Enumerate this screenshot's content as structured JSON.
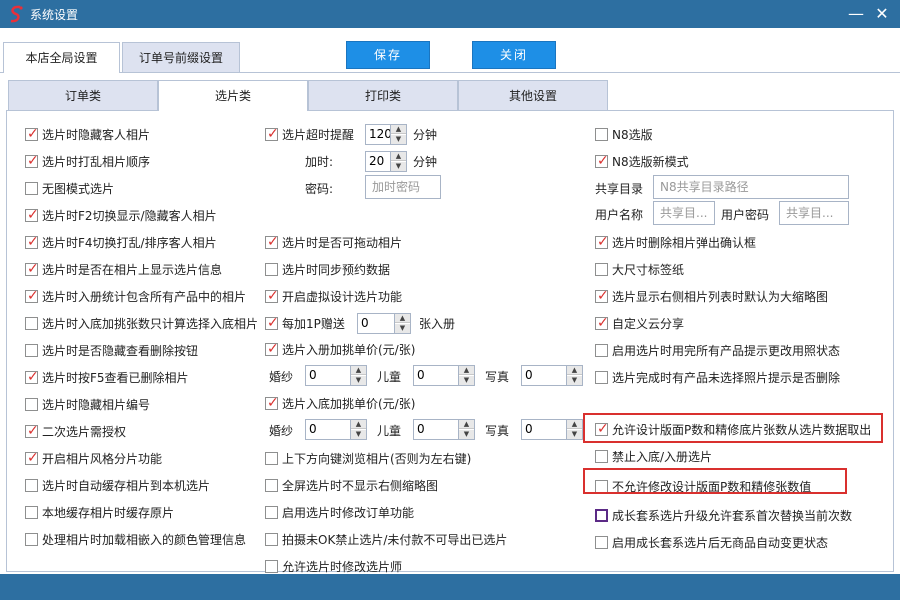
{
  "window": {
    "title": "系统设置",
    "minimize": "—",
    "close": "✕"
  },
  "top_tabs": [
    "本店全局设置",
    "订单号前缀设置"
  ],
  "buttons": {
    "save": "保存",
    "close": "关闭"
  },
  "sub_tabs": [
    "订单类",
    "选片类",
    "打印类",
    "其他设置"
  ],
  "col1": [
    {
      "label": "选片时隐藏客人相片",
      "checked": true
    },
    {
      "label": "选片时打乱相片顺序",
      "checked": true
    },
    {
      "label": "无图模式选片",
      "checked": false
    },
    {
      "label": "选片时F2切换显示/隐藏客人相片",
      "checked": true
    },
    {
      "label": "选片时F4切换打乱/排序客人相片",
      "checked": true
    },
    {
      "label": "选片时是否在相片上显示选片信息",
      "checked": true
    },
    {
      "label": "选片时入册统计包含所有产品中的相片",
      "checked": true
    },
    {
      "label": "选片时入底加挑张数只计算选择入底相片",
      "checked": false
    },
    {
      "label": "选片时是否隐藏查看删除按钮",
      "checked": false
    },
    {
      "label": "选片时按F5查看已删除相片",
      "checked": true
    },
    {
      "label": "选片时隐藏相片编号",
      "checked": false
    },
    {
      "label": "二次选片需授权",
      "checked": true
    },
    {
      "label": "开启相片风格分片功能",
      "checked": true
    },
    {
      "label": "选片时自动缓存相片到本机选片",
      "checked": false
    },
    {
      "label": "本地缓存相片时缓存原片",
      "checked": false
    },
    {
      "label": "处理相片时加载相嵌入的颜色管理信息",
      "checked": false
    }
  ],
  "col2": {
    "timeout": {
      "label": "选片超时提醒",
      "checked": true,
      "value": "120",
      "unit": "分钟"
    },
    "add_time": {
      "label": "加时:",
      "value": "20",
      "unit": "分钟"
    },
    "password": {
      "label": "密码:",
      "placeholder": "加时密码"
    },
    "drag": {
      "label": "选片时是否可拖动相片",
      "checked": true
    },
    "sync": {
      "label": "选片时同步预约数据",
      "checked": false
    },
    "virtual_design": {
      "label": "开启虚拟设计选片功能",
      "checked": true
    },
    "bonus": {
      "label": "每加1P赠送",
      "checked": true,
      "value": "0",
      "suffix": "张入册"
    },
    "album_price": {
      "label": "选片入册加挑单价(元/张)",
      "checked": true
    },
    "album_row": {
      "wedding": "婚纱",
      "wedding_val": "0",
      "child": "儿童",
      "child_val": "0",
      "portrait": "写真",
      "portrait_val": "0"
    },
    "base_price": {
      "label": "选片入底加挑单价(元/张)",
      "checked": true
    },
    "base_row": {
      "wedding": "婚纱",
      "wedding_val": "0",
      "child": "儿童",
      "child_val": "0",
      "portrait": "写真",
      "portrait_val": "0"
    },
    "updown": {
      "label": "上下方向键浏览相片(否则为左右键)",
      "checked": false
    },
    "fullscreen": {
      "label": "全屏选片时不显示右侧缩略图",
      "checked": false
    },
    "modify_order": {
      "label": "启用选片时修改订单功能",
      "checked": false
    },
    "no_ok": {
      "label": "拍摄未OK禁止选片/未付款不可导出已选片",
      "checked": false
    },
    "modify_selector": {
      "label": "允许选片时修改选片师",
      "checked": false
    }
  },
  "col3": {
    "n8": {
      "label": "N8选版",
      "checked": false
    },
    "n8_new": {
      "label": "N8选版新模式",
      "checked": true
    },
    "share_dir": {
      "label": "共享目录",
      "placeholder": "N8共享目录路径"
    },
    "username": {
      "label": "用户名称",
      "placeholder": "共享目..."
    },
    "userpass": {
      "label": "用户密码",
      "placeholder": "共享目..."
    },
    "items": [
      {
        "label": "选片时删除相片弹出确认框",
        "checked": true
      },
      {
        "label": "大尺寸标签纸",
        "checked": false
      },
      {
        "label": "选片显示右侧相片列表时默认为大缩略图",
        "checked": true
      },
      {
        "label": "自定义云分享",
        "checked": true
      },
      {
        "label": "启用选片时用完所有产品提示更改用照状态",
        "checked": false
      },
      {
        "label": "选片完成时有产品未选择照片提示是否删除",
        "checked": false
      },
      {
        "label": "允许设计版面P数和精修底片张数从选片数据取出",
        "checked": true
      },
      {
        "label": "禁止入底/入册选片",
        "checked": false
      },
      {
        "label": "不允许修改设计版面P数和精修张数值",
        "checked": false
      },
      {
        "label": "成长套系选片升级允许套系首次替换当前次数",
        "checked": false
      },
      {
        "label": "启用成长套系选片后无商品自动变更状态",
        "checked": false
      }
    ]
  },
  "colors": {
    "titlebar": "#2d6fa1",
    "button": "#1e8fe6",
    "check": "#d9302e",
    "highlight": "#d9302e"
  }
}
